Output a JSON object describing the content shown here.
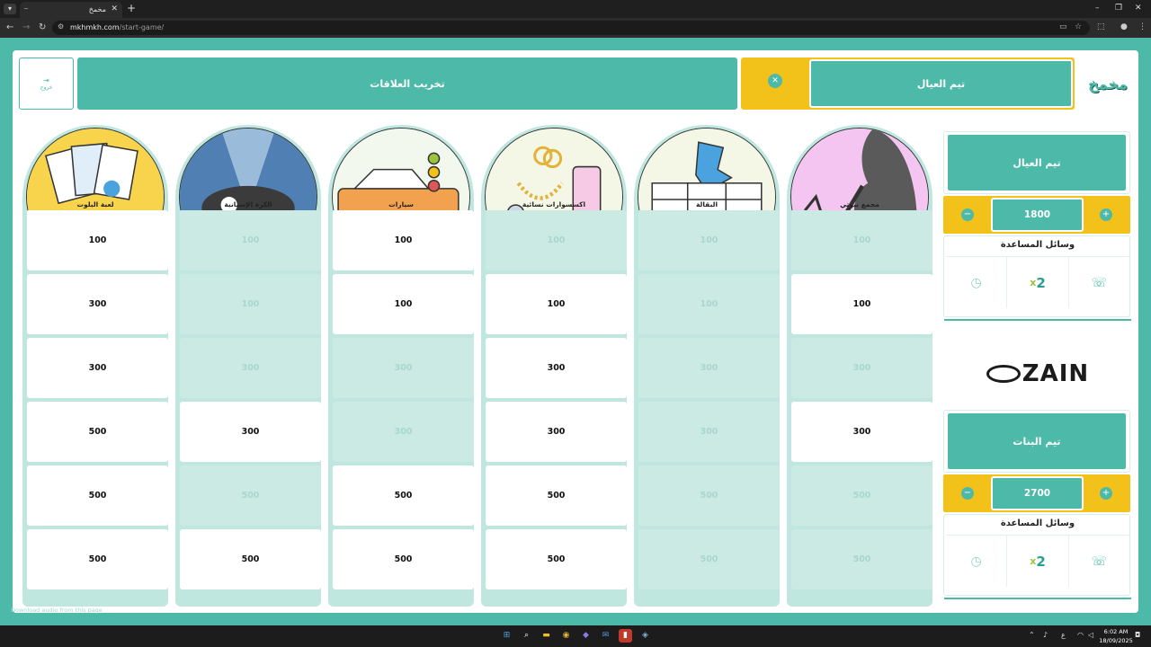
{
  "browser": {
    "tab_title": "مخمخ",
    "url_host": "mkhmkh.com",
    "url_path": "/start-game/",
    "window_controls": [
      "–",
      "❐",
      "✕"
    ]
  },
  "header": {
    "exit_label": "خروج",
    "active_ability": "تخريب العلاقات",
    "current_turn_team": "تيم العيال",
    "logo_text": "مخمخ"
  },
  "categories": [
    {
      "name": "لعبة البلوت",
      "values": [
        "100",
        "300",
        "300",
        "500",
        "500",
        "500"
      ],
      "enabled": [
        true,
        true,
        true,
        true,
        true,
        true
      ]
    },
    {
      "name": "الكرة الإسبانية",
      "values": [
        "100",
        "100",
        "300",
        "300",
        "500",
        "500"
      ],
      "enabled": [
        false,
        false,
        false,
        true,
        false,
        true
      ]
    },
    {
      "name": "سيارات",
      "values": [
        "100",
        "100",
        "300",
        "300",
        "500",
        "500"
      ],
      "enabled": [
        true,
        true,
        false,
        false,
        true,
        true
      ]
    },
    {
      "name": "اكسسوارات نسائية",
      "values": [
        "100",
        "100",
        "300",
        "300",
        "500",
        "500"
      ],
      "enabled": [
        false,
        true,
        true,
        true,
        true,
        true
      ]
    },
    {
      "name": "البقالة",
      "values": [
        "100",
        "100",
        "300",
        "300",
        "500",
        "500"
      ],
      "enabled": [
        false,
        false,
        false,
        false,
        false,
        false
      ]
    },
    {
      "name": "مجمع بيوتي",
      "values": [
        "100",
        "100",
        "300",
        "300",
        "500",
        "500"
      ],
      "enabled": [
        false,
        true,
        false,
        true,
        false,
        false
      ]
    }
  ],
  "teams": [
    {
      "name": "تيم العيال",
      "score": "1800",
      "aids_title": "وسائل المساعدة",
      "aids": {
        "double": "2",
        "double_prefix": "x"
      }
    },
    {
      "name": "تيم البنات",
      "score": "2700",
      "aids_title": "وسائل المساعدة",
      "aids": {
        "double": "2",
        "double_prefix": "x"
      }
    }
  ],
  "sponsor": "ZAIN",
  "download_bar": "Download audio from this page",
  "taskbar": {
    "time": "6:02 AM",
    "date": "18/09/2025",
    "lang": "ع"
  }
}
